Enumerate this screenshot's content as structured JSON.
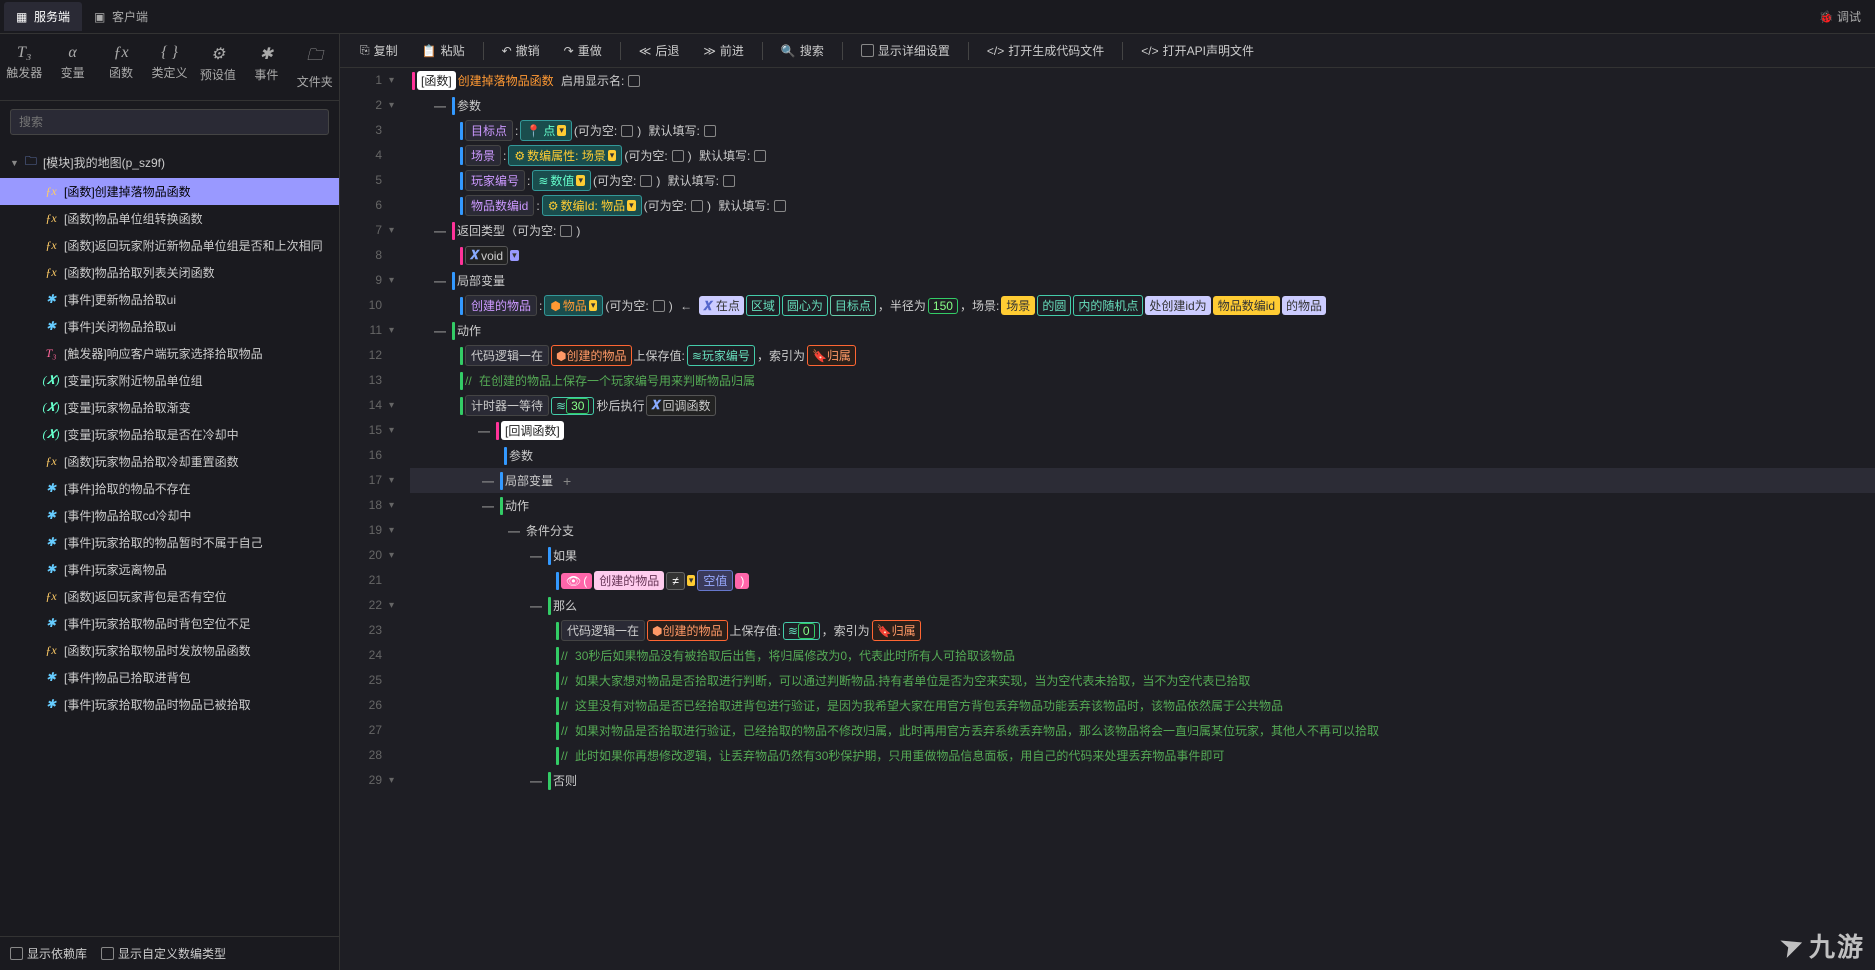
{
  "tabs": {
    "server": "服务端",
    "client": "客户端",
    "debug": "调试"
  },
  "tools": [
    "触发器",
    "变量",
    "函数",
    "类定义",
    "预设值",
    "事件",
    "文件夹"
  ],
  "search": {
    "placeholder": "搜索"
  },
  "treeRoot": "[模块]我的地图(p_sz9f)",
  "tree": [
    {
      "icon": "fx",
      "label": "[函数]创建掉落物品函数",
      "sel": true
    },
    {
      "icon": "fx",
      "label": "[函数]物品单位组转换函数"
    },
    {
      "icon": "fx",
      "label": "[函数]返回玩家附近新物品单位组是否和上次相同"
    },
    {
      "icon": "fx",
      "label": "[函数]物品拾取列表关闭函数"
    },
    {
      "icon": "ev",
      "label": "[事件]更新物品拾取ui"
    },
    {
      "icon": "ev",
      "label": "[事件]关闭物品拾取ui"
    },
    {
      "icon": "tr",
      "label": "[触发器]响应客户端玩家选择拾取物品"
    },
    {
      "icon": "var",
      "label": "[变量]玩家附近物品单位组"
    },
    {
      "icon": "var",
      "label": "[变量]玩家物品拾取渐变"
    },
    {
      "icon": "var",
      "label": "[变量]玩家物品拾取是否在冷却中"
    },
    {
      "icon": "fx",
      "label": "[函数]玩家物品拾取冷却重置函数"
    },
    {
      "icon": "ev",
      "label": "[事件]拾取的物品不存在"
    },
    {
      "icon": "ev",
      "label": "[事件]物品拾取cd冷却中"
    },
    {
      "icon": "ev",
      "label": "[事件]玩家拾取的物品暂时不属于自己"
    },
    {
      "icon": "ev",
      "label": "[事件]玩家远离物品"
    },
    {
      "icon": "fx",
      "label": "[函数]返回玩家背包是否有空位"
    },
    {
      "icon": "ev",
      "label": "[事件]玩家拾取物品时背包空位不足"
    },
    {
      "icon": "fx",
      "label": "[函数]玩家拾取物品时发放物品函数"
    },
    {
      "icon": "ev",
      "label": "[事件]物品已拾取进背包"
    },
    {
      "icon": "ev",
      "label": "[事件]玩家拾取物品时物品已被拾取"
    }
  ],
  "footer": {
    "dep": "显示依赖库",
    "custom": "显示自定义数编类型"
  },
  "toolbar": {
    "copy": "复制",
    "paste": "粘贴",
    "undo": "撤销",
    "redo": "重做",
    "back": "后退",
    "forward": "前进",
    "search": "搜索",
    "detail": "显示详细设置",
    "openGen": "打开生成代码文件",
    "openApi": "打开API声明文件"
  },
  "code": {
    "l1a": "[函数]",
    "l1b": "创建掉落物品函数",
    "l1c": "启用显示名:",
    "l2": "参数",
    "l3a": "目标点",
    "l3b": "点",
    "l3c": "(可为空:",
    "l3d": ")",
    "l3e": "默认填写:",
    "l4a": "场景",
    "l4b": "数编属性: 场景",
    "l4c": "(可为空:",
    "l4d": "默认填写:",
    "l5a": "玩家编号",
    "l5b": "数值",
    "l5c": "(可为空:",
    "l5d": "默认填写:",
    "l6a": "物品数编id",
    "l6b": "数编Id: 物品",
    "l6c": "(可为空:",
    "l6d": "默认填写:",
    "l7": "返回类型（可为空:",
    "l8": "void",
    "l9": "局部变量",
    "l10a": "创建的物品",
    "l10b": "物品",
    "l10c": "(可为空:",
    "l10arrow": "←",
    "l10d": "在点",
    "l10e": "区域",
    "l10f": "圆心为",
    "l10g": "目标点",
    "l10h": "，半径为",
    "l10i": "150",
    "l10j": "，场景:",
    "l10k": "场景",
    "l10l": "的圆",
    "l10m": "内的随机点",
    "l10n": "处创建id为",
    "l10o": "物品数编id",
    "l10p": "的物品",
    "l11": "动作",
    "l12a": "代码逻辑一在",
    "l12b": "创建的物品",
    "l12c": "上保存值:",
    "l12d": "玩家编号",
    "l12e": "，索引为",
    "l12f": "归属",
    "l13": "在创建的物品上保存一个玩家编号用来判断物品归属",
    "l14a": "计时器一等待",
    "l14b": "30",
    "l14c": "秒后执行",
    "l14d": "回调函数",
    "l15": "[回调函数]",
    "l16": "参数",
    "l17": "局部变量",
    "l18": "动作",
    "l19": "条件分支",
    "l20": "如果",
    "l21a": "(",
    "l21b": "创建的物品",
    "l21c": "≠",
    "l21d": "空值",
    "l21e": ")",
    "l22": "那么",
    "l23a": "代码逻辑一在",
    "l23b": "创建的物品",
    "l23c": "上保存值:",
    "l23d": "0",
    "l23e": "，索引为",
    "l23f": "归属",
    "l24": "30秒后如果物品没有被拾取后出售，将归属修改为0，代表此时所有人可拾取该物品",
    "l25": "如果大家想对物品是否拾取进行判断，可以通过判断物品.持有者单位是否为空来实现，当为空代表未拾取，当不为空代表已拾取",
    "l26": "这里没有对物品是否已经拾取进背包进行验证，是因为我希望大家在用官方背包丢弃物品功能丢弃该物品时，该物品依然属于公共物品",
    "l27": "如果对物品是否拾取进行验证，已经拾取的物品不修改归属，此时再用官方丢弃系统丢弃物品，那么该物品将会一直归属某位玩家，其他人不再可以拾取",
    "l28": "此时如果你再想修改逻辑，让丢弃物品仍然有30秒保护期，只用重做物品信息面板，用自己的代码来处理丢弃物品事件即可",
    "l29": "否则"
  },
  "watermark": "九游"
}
